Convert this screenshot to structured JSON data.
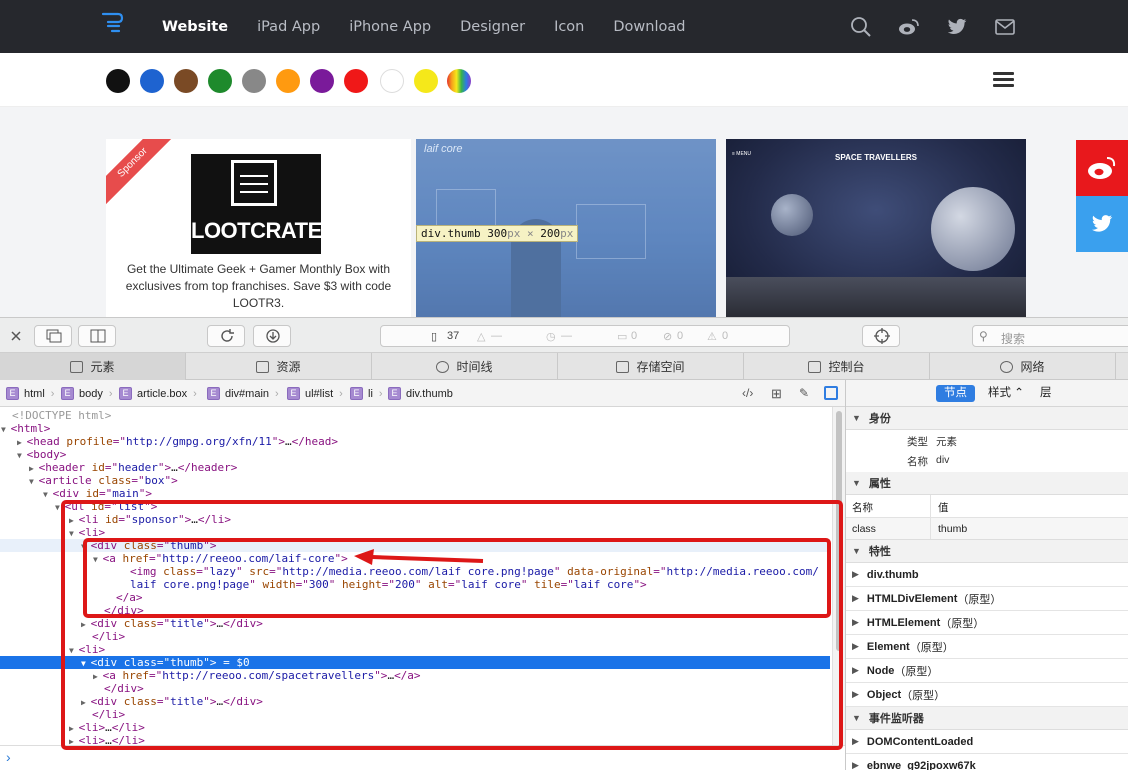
{
  "nav": {
    "links": [
      "Website",
      "iPad App",
      "iPhone App",
      "Designer",
      "Icon",
      "Download"
    ],
    "icons": [
      "search-icon",
      "weibo-icon",
      "twitter-icon",
      "mail-icon"
    ]
  },
  "colors": {
    "swatches": [
      "#111111",
      "#1e63d0",
      "#7a4a25",
      "#1e8a2c",
      "#888888",
      "#ff9a10",
      "#7a1a9a",
      "#f01818",
      "#ffffff",
      "#f5e81a",
      "rainbow"
    ],
    "accent_red": "#dd1717",
    "selection_blue": "#1a73e8"
  },
  "content": {
    "sponsor_ribbon": "Sponsor",
    "sponsor_logo": "LOOTCRATE",
    "sponsor_text": "Get the Ultimate Geek + Gamer Monthly Box with exclusives from top franchises. Save $3 with code LOOTR3.",
    "thumb1_brand": "laif core",
    "thumb2_menu": "≡ MENU",
    "thumb2_title": "SPACE TRAVELLERS",
    "tooltip": {
      "sel": "div.thumb",
      "w": "300",
      "x": " × ",
      "h": "200",
      "unit": "px"
    },
    "share_icons": [
      "weibo-icon",
      "twitter-icon"
    ]
  },
  "toolbar": {
    "count": "37",
    "s1": "—",
    "s2": "—",
    "s3": "0",
    "s4": "0",
    "s5": "0",
    "search_placeholder": "搜索"
  },
  "tabs": [
    "元素",
    "资源",
    "时间线",
    "存储空间",
    "控制台",
    "网络"
  ],
  "breadcrumb": [
    "html",
    "body",
    "article.box",
    "div#main",
    "ul#list",
    "li",
    "div.thumb"
  ],
  "dom": [
    {
      "tri": "",
      "parts": [
        [
          "c",
          "<!DOCTYPE html>"
        ]
      ]
    },
    {
      "tri": "▼",
      "parts": [
        [
          "t",
          "<html>"
        ]
      ]
    },
    {
      "tri": "▶",
      "parts": [
        [
          "t",
          "<head "
        ],
        [
          "a",
          "profile"
        ],
        [
          "t",
          "=\""
        ],
        [
          "v",
          "http://gmpg.org/xfn/11"
        ],
        [
          "t",
          "\">"
        ],
        [
          "x",
          "…"
        ],
        [
          "t",
          "</head>"
        ]
      ]
    },
    {
      "tri": "▼",
      "parts": [
        [
          "t",
          "<body>"
        ]
      ]
    },
    {
      "tri": "▶",
      "parts": [
        [
          "t",
          "<header "
        ],
        [
          "a",
          "id"
        ],
        [
          "t",
          "=\""
        ],
        [
          "v",
          "header"
        ],
        [
          "t",
          "\">"
        ],
        [
          "x",
          "…"
        ],
        [
          "t",
          "</header>"
        ]
      ]
    },
    {
      "tri": "▼",
      "parts": [
        [
          "t",
          "<article "
        ],
        [
          "a",
          "class"
        ],
        [
          "t",
          "=\""
        ],
        [
          "v",
          "box"
        ],
        [
          "t",
          "\">"
        ]
      ]
    },
    {
      "tri": "▼",
      "parts": [
        [
          "t",
          "<div "
        ],
        [
          "a",
          "id"
        ],
        [
          "t",
          "=\""
        ],
        [
          "v",
          "main"
        ],
        [
          "t",
          "\">"
        ]
      ]
    },
    {
      "tri": "▼",
      "parts": [
        [
          "t",
          "<ul "
        ],
        [
          "a",
          "id"
        ],
        [
          "t",
          "=\""
        ],
        [
          "v",
          "list"
        ],
        [
          "t",
          "\">"
        ]
      ]
    },
    {
      "tri": "▶",
      "parts": [
        [
          "t",
          "<li "
        ],
        [
          "a",
          "id"
        ],
        [
          "t",
          "=\""
        ],
        [
          "v",
          "sponsor"
        ],
        [
          "t",
          "\">"
        ],
        [
          "x",
          "…"
        ],
        [
          "t",
          "</li>"
        ]
      ]
    },
    {
      "tri": "▼",
      "parts": [
        [
          "t",
          "<li>"
        ]
      ]
    },
    {
      "tri": "▼",
      "parts": [
        [
          "t",
          "<div "
        ],
        [
          "a",
          "class"
        ],
        [
          "t",
          "=\""
        ],
        [
          "v",
          "thumb"
        ],
        [
          "t",
          "\">"
        ]
      ]
    },
    {
      "tri": "▼",
      "parts": [
        [
          "t",
          "<a "
        ],
        [
          "a",
          "href"
        ],
        [
          "t",
          "=\""
        ],
        [
          "v",
          "http://reeoo.com/laif-core"
        ],
        [
          "t",
          "\">"
        ]
      ]
    },
    {
      "tri": "",
      "parts": [
        [
          "t",
          "<img "
        ],
        [
          "a",
          "class"
        ],
        [
          "t",
          "=\""
        ],
        [
          "v",
          "lazy"
        ],
        [
          "t",
          "\" "
        ],
        [
          "a",
          "src"
        ],
        [
          "t",
          "=\""
        ],
        [
          "v",
          "http://media.reeoo.com/laif core.png!page"
        ],
        [
          "t",
          "\" "
        ],
        [
          "a",
          "data-original"
        ],
        [
          "t",
          "=\""
        ],
        [
          "v",
          "http://media.reeoo.com/"
        ]
      ]
    },
    {
      "tri": "",
      "parts": [
        [
          "v",
          "laif core.png!page"
        ],
        [
          "t",
          "\" "
        ],
        [
          "a",
          "width"
        ],
        [
          "t",
          "=\""
        ],
        [
          "v",
          "300"
        ],
        [
          "t",
          "\" "
        ],
        [
          "a",
          "height"
        ],
        [
          "t",
          "=\""
        ],
        [
          "v",
          "200"
        ],
        [
          "t",
          "\" "
        ],
        [
          "a",
          "alt"
        ],
        [
          "t",
          "=\""
        ],
        [
          "v",
          "laif core"
        ],
        [
          "t",
          "\" "
        ],
        [
          "a",
          "tile"
        ],
        [
          "t",
          "=\""
        ],
        [
          "v",
          "laif core"
        ],
        [
          "t",
          "\">"
        ]
      ]
    },
    {
      "tri": "",
      "parts": [
        [
          "t",
          "</a>"
        ]
      ]
    },
    {
      "tri": "",
      "parts": [
        [
          "t",
          "</div>"
        ]
      ]
    },
    {
      "tri": "▶",
      "parts": [
        [
          "t",
          "<div "
        ],
        [
          "a",
          "class"
        ],
        [
          "t",
          "=\""
        ],
        [
          "v",
          "title"
        ],
        [
          "t",
          "\">"
        ],
        [
          "x",
          "…"
        ],
        [
          "t",
          "</div>"
        ]
      ]
    },
    {
      "tri": "",
      "parts": [
        [
          "t",
          "</li>"
        ]
      ]
    },
    {
      "tri": "▼",
      "parts": [
        [
          "t",
          "<li>"
        ]
      ]
    },
    {
      "tri": "▼",
      "parts": [
        [
          "t",
          "<div "
        ],
        [
          "a",
          "class"
        ],
        [
          "t",
          "=\""
        ],
        [
          "v",
          "thumb"
        ],
        [
          "t",
          "\">"
        ],
        [
          "x",
          " = $0"
        ]
      ]
    },
    {
      "tri": "▶",
      "parts": [
        [
          "t",
          "<a "
        ],
        [
          "a",
          "href"
        ],
        [
          "t",
          "=\""
        ],
        [
          "v",
          "http://reeoo.com/spacetravellers"
        ],
        [
          "t",
          "\">"
        ],
        [
          "x",
          "…"
        ],
        [
          "t",
          "</a>"
        ]
      ]
    },
    {
      "tri": "",
      "parts": [
        [
          "t",
          "</div>"
        ]
      ]
    },
    {
      "tri": "▶",
      "parts": [
        [
          "t",
          "<div "
        ],
        [
          "a",
          "class"
        ],
        [
          "t",
          "=\""
        ],
        [
          "v",
          "title"
        ],
        [
          "t",
          "\">"
        ],
        [
          "x",
          "…"
        ],
        [
          "t",
          "</div>"
        ]
      ]
    },
    {
      "tri": "",
      "parts": [
        [
          "t",
          "</li>"
        ]
      ]
    },
    {
      "tri": "▶",
      "parts": [
        [
          "t",
          "<li>"
        ],
        [
          "x",
          "…"
        ],
        [
          "t",
          "</li>"
        ]
      ]
    },
    {
      "tri": "▶",
      "parts": [
        [
          "t",
          "<li>"
        ],
        [
          "x",
          "…"
        ],
        [
          "t",
          "</li>"
        ]
      ]
    }
  ],
  "sidebar": {
    "tabs": [
      "节点",
      "样式 ⌃",
      "层"
    ],
    "identity_header": "身份",
    "type_label": "类型",
    "type_value": "元素",
    "name_label": "名称",
    "name_value": "div",
    "attrs_header": "属性",
    "attr_col_name": "名称",
    "attr_col_value": "值",
    "attr_name": "class",
    "attr_value": "thumb",
    "props_header": "特性",
    "props": [
      {
        "name": "div.thumb",
        "suffix": ""
      },
      {
        "name": "HTMLDivElement",
        "suffix": "（原型）"
      },
      {
        "name": "HTMLElement",
        "suffix": "（原型）"
      },
      {
        "name": "Element",
        "suffix": "（原型）"
      },
      {
        "name": "Node",
        "suffix": "（原型）"
      },
      {
        "name": "Object",
        "suffix": "（原型）"
      }
    ],
    "events_header": "事件监听器",
    "events": [
      "DOMContentLoaded",
      "ebnwe_g92jpoxw67k"
    ]
  }
}
